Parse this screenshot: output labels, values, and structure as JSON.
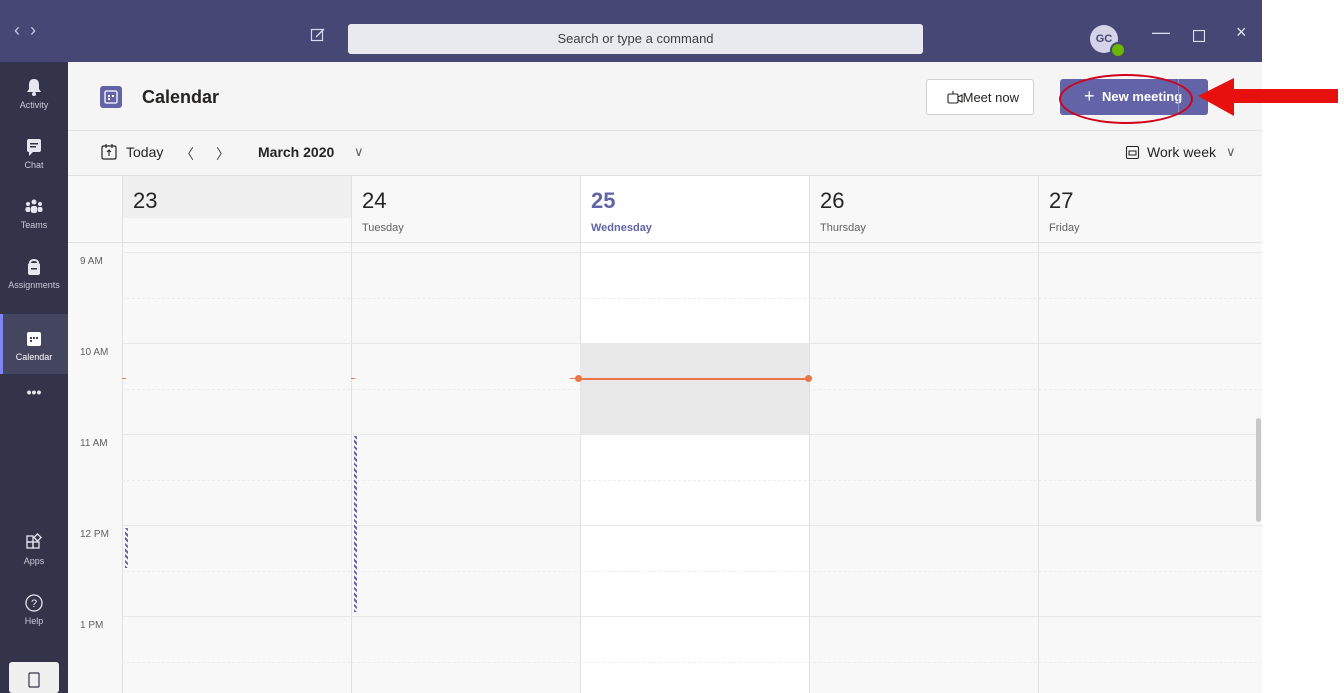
{
  "titlebar": {
    "back_icon": "chevron-left-icon",
    "forward_icon": "chevron-right-icon",
    "compose_icon": "compose-icon",
    "search_placeholder": "Search or type a command",
    "avatar_initials": "GC",
    "presence": "available",
    "window_controls": [
      "minimize-icon",
      "maximize-icon",
      "close-icon"
    ]
  },
  "rail": {
    "items": [
      {
        "label": "Activity",
        "icon": "bell-icon"
      },
      {
        "label": "Chat",
        "icon": "chat-icon"
      },
      {
        "label": "Teams",
        "icon": "teams-icon"
      },
      {
        "label": "Assignments",
        "icon": "assignments-icon"
      },
      {
        "label": "Calendar",
        "icon": "calendar-icon",
        "active": true
      },
      {
        "label": "",
        "icon": "more-icon"
      }
    ],
    "bottom_items": [
      {
        "label": "Apps",
        "icon": "apps-icon"
      },
      {
        "label": "Help",
        "icon": "help-icon"
      }
    ],
    "more_glyph": "•••"
  },
  "header": {
    "title": "Calendar",
    "meet_now_label": "Meet now",
    "new_meeting_label": "New meeting",
    "new_meeting_plus": "+"
  },
  "toolbar": {
    "today_label": "Today",
    "prev_glyph": "〈",
    "next_glyph": "〉",
    "month_label": "March 2020",
    "view_label": "Work week",
    "dropdown_glyph": "∨"
  },
  "calendar": {
    "days": [
      {
        "number": "23",
        "name": ""
      },
      {
        "number": "24",
        "name": "Tuesday"
      },
      {
        "number": "25",
        "name": "Wednesday",
        "today": true
      },
      {
        "number": "26",
        "name": "Thursday"
      },
      {
        "number": "27",
        "name": "Friday"
      }
    ],
    "hours": [
      "9 AM",
      "10 AM",
      "11 AM",
      "12 PM",
      "1 PM"
    ]
  },
  "colors": {
    "brand": "#6264a7",
    "titlebar": "#464775",
    "rail": "#33344a",
    "now_line": "#e97548",
    "annotation": "#d0021b"
  }
}
